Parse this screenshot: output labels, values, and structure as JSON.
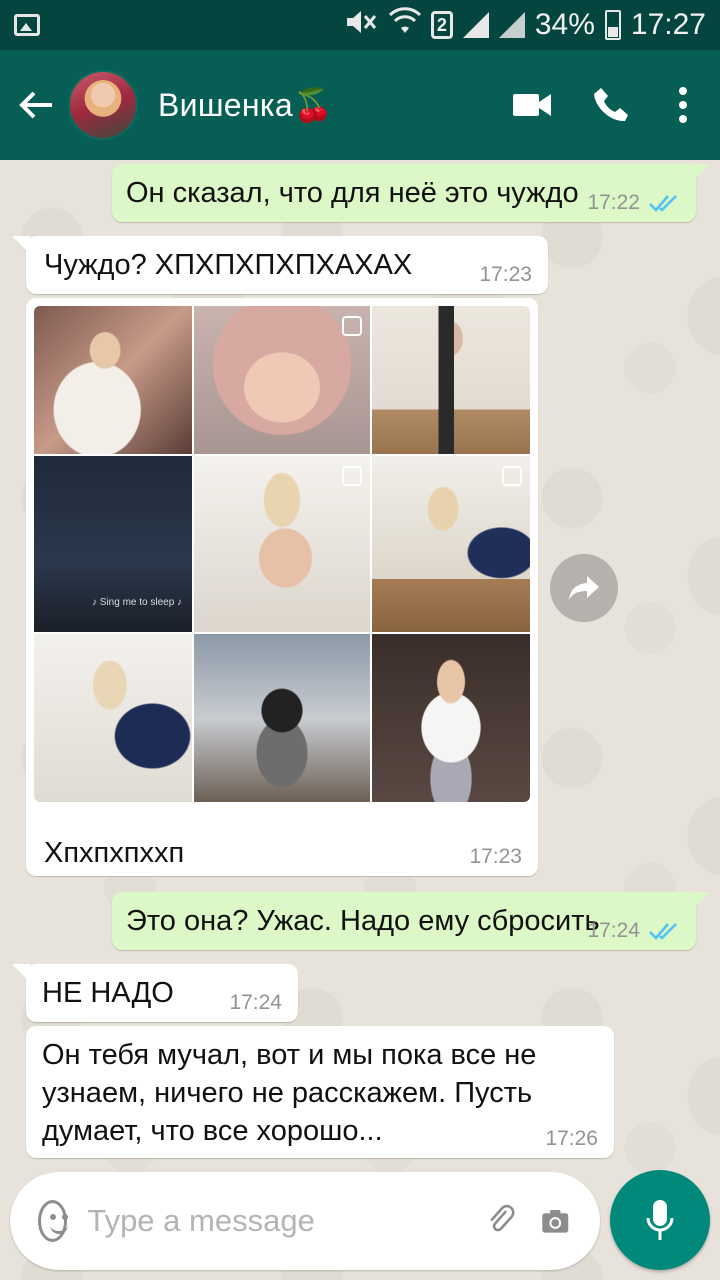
{
  "status_bar": {
    "sim": "2",
    "battery": "34%",
    "time": "17:27"
  },
  "header": {
    "contact_name": "Вишенка🍒"
  },
  "messages": [
    {
      "direction": "out",
      "text": "Он сказал, что для неё это чуждо",
      "time": "17:22",
      "status": "read"
    },
    {
      "direction": "in",
      "text": "Чуждо? ХПХПХПХПХАХАХ",
      "time": "17:23"
    },
    {
      "direction": "in",
      "type": "image",
      "caption": "Хпхпхпххп",
      "time": "17:23",
      "inner_caption": "♪ Sing me to sleep ♪"
    },
    {
      "direction": "out",
      "text": "Это она? Ужас. Надо ему сбросить",
      "time": "17:24",
      "status": "read"
    },
    {
      "direction": "in",
      "text": "НЕ НАДО",
      "time": "17:24"
    },
    {
      "direction": "in",
      "text": "Он тебя мучал, вот и мы пока все не узнаем, ничего не расскажем. Пусть думает, что все хорошо...",
      "time": "17:26"
    }
  ],
  "input": {
    "placeholder": "Type a message",
    "value": ""
  },
  "colors": {
    "app_bar": "#075e54",
    "status_bar": "#04463f",
    "outgoing_bubble": "#dcf8c6",
    "incoming_bubble": "#ffffff",
    "read_ticks": "#4fc3f7",
    "fab": "#00897b"
  },
  "icons": [
    "gallery-icon",
    "mute-icon",
    "wifi-icon",
    "signal-icon",
    "battery-icon",
    "back-arrow-icon",
    "video-call-icon",
    "phone-icon",
    "more-vert-icon",
    "forward-icon",
    "emoji-icon",
    "attach-icon",
    "camera-icon",
    "mic-icon"
  ]
}
